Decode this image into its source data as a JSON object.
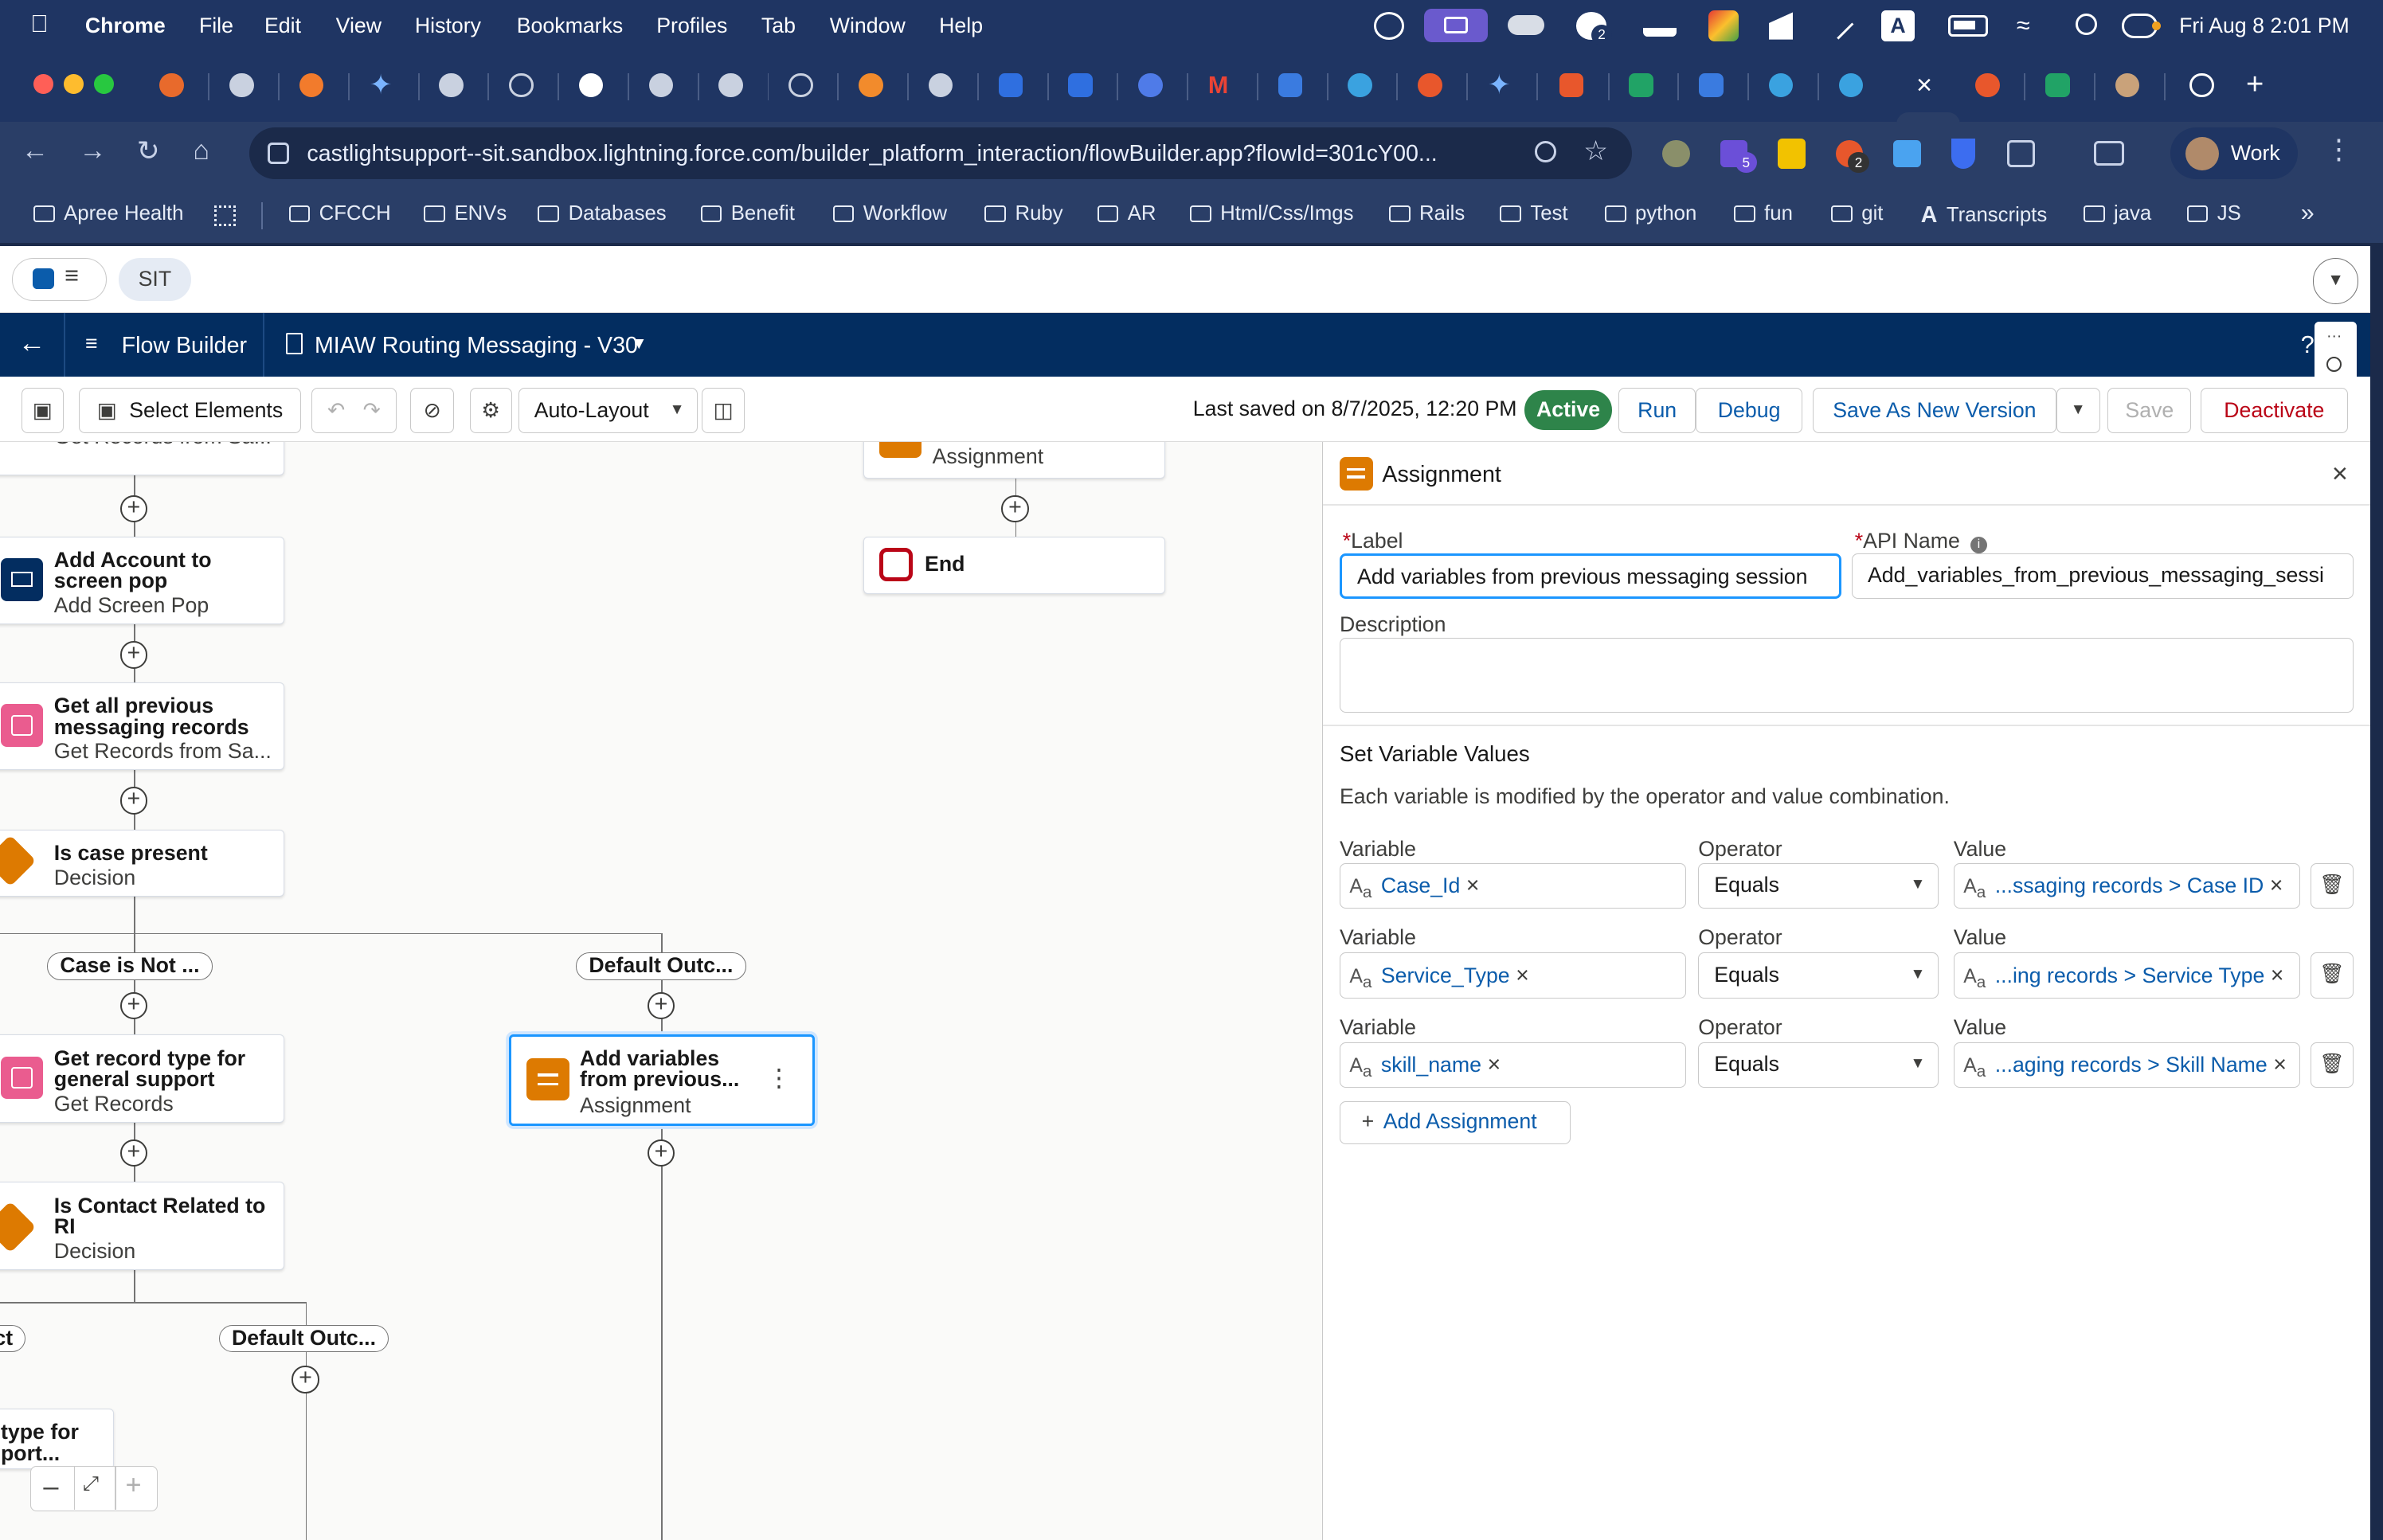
{
  "menubar": {
    "app": "Chrome",
    "items": [
      "File",
      "Edit",
      "View",
      "History",
      "Bookmarks",
      "Profiles",
      "Tab",
      "Window",
      "Help"
    ],
    "clock": "Fri Aug 8  2:01 PM"
  },
  "browser": {
    "url": "castlightsupport--sit.sandbox.lightning.force.com/builder_platform_interaction/flowBuilder.app?flowId=301cY00...",
    "profile_label": "Work",
    "extension_badges": [
      "5",
      "2"
    ],
    "tray_badge": "2"
  },
  "bookmarks": [
    "Apree Health",
    "CFCCH",
    "ENVs",
    "Databases",
    "Benefit",
    "Workflow",
    "Ruby",
    "AR",
    "Html/Css/Imgs",
    "Rails",
    "Test",
    "python",
    "fun",
    "git",
    "Transcripts",
    "java",
    "JS"
  ],
  "sf": {
    "env_label": "SIT",
    "app_name": "Flow Builder",
    "flow_name": "MIAW Routing Messaging - V30"
  },
  "toolbar": {
    "select_elements": "Select Elements",
    "layout": "Auto-Layout",
    "last_saved": "Last saved on 8/7/2025, 12:20 PM",
    "status": "Active",
    "run": "Run",
    "debug": "Debug",
    "save_as_new": "Save As New Version",
    "save": "Save",
    "deactivate": "Deactivate"
  },
  "canvas": {
    "nodes": {
      "get_records_top": {
        "title": "",
        "sub": "Get Records from Sa..."
      },
      "screen_pop": {
        "title": "Add Account to screen pop",
        "sub": "Add Screen Pop"
      },
      "get_prev": {
        "title": "Get all previous messaging records",
        "sub": "Get Records from Sa..."
      },
      "case_present": {
        "title": "Is case present",
        "sub": "Decision"
      },
      "record_type": {
        "title": "Get record type for general support",
        "sub": "Get Records"
      },
      "contact_related": {
        "title": "Is Contact Related to RI",
        "sub": "Decision"
      },
      "add_vars": {
        "title": "Add variables from previous...",
        "sub": "Assignment"
      },
      "assignment_top": {
        "sub": "Assignment"
      },
      "end": {
        "title": "End"
      },
      "partial_bottom": {
        "title": "type for port..."
      }
    },
    "outcomes": {
      "case_not": "Case is Not ...",
      "default1": "Default Outc...",
      "partial_left": "ct",
      "default2": "Default Outc..."
    }
  },
  "panel": {
    "header": "Assignment",
    "label_label": "Label",
    "label_value": "Add variables from previous messaging session",
    "api_label": "API Name",
    "api_value": "Add_variables_from_previous_messaging_sessi",
    "description_label": "Description",
    "description_value": "",
    "section_title": "Set Variable Values",
    "section_help": "Each variable is modified by the operator and value combination.",
    "col_variable": "Variable",
    "col_operator": "Operator",
    "col_value": "Value",
    "rows": [
      {
        "variable": "Case_Id",
        "operator": "Equals",
        "value": "...ssaging records > Case ID"
      },
      {
        "variable": "Service_Type",
        "operator": "Equals",
        "value": "...ing records > Service Type"
      },
      {
        "variable": "skill_name",
        "operator": "Equals",
        "value": "...aging records > Skill Name"
      }
    ],
    "add_assignment": "Add Assignment"
  },
  "colors": {
    "mac_bar": "#1f3563",
    "sf_nav": "#032d60",
    "active_green": "#2e844a",
    "assignment_orange": "#dd7a01",
    "get_records_pink": "#ea5c8f",
    "decision_orange": "#dd7a01",
    "screen_navy": "#032d60",
    "link_blue": "#0b5cab",
    "deactivate_red": "#ba0517"
  }
}
